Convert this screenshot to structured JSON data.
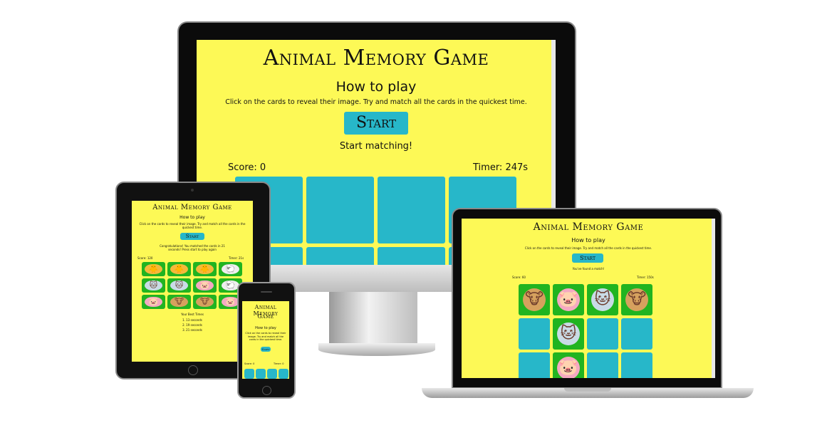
{
  "game": {
    "title": "Animal Memory Game",
    "title_small": "Animal Memory Game",
    "how_to_play": "How to play",
    "instructions": "Click on the cards to reveal their image. Try and match all the cards in the quickest time.",
    "start_label": "Start",
    "accent_color": "#27b7c9",
    "background_color": "#fdf956",
    "matched_color": "#21b420"
  },
  "desktop": {
    "status": "Start matching!",
    "score_label": "Score: 0",
    "timer_label": "Timer: 247s"
  },
  "laptop": {
    "status": "You've found a match!",
    "score_label": "Score: 60",
    "timer_label": "Timer: 150s",
    "cards": [
      {
        "state": "open",
        "animal": "cow"
      },
      {
        "state": "open",
        "animal": "pig"
      },
      {
        "state": "open",
        "animal": "cat"
      },
      {
        "state": "open",
        "animal": "cow"
      },
      {
        "state": "closed",
        "animal": ""
      },
      {
        "state": "open",
        "animal": "cat"
      },
      {
        "state": "closed",
        "animal": ""
      },
      {
        "state": "closed",
        "animal": ""
      },
      {
        "state": "closed",
        "animal": ""
      },
      {
        "state": "open",
        "animal": "pig"
      },
      {
        "state": "closed",
        "animal": ""
      },
      {
        "state": "closed",
        "animal": ""
      }
    ]
  },
  "tablet": {
    "status": "Congratulations! You matched the cards in 21 seconds! Press start to play again",
    "score_label": "Score: 120",
    "timer_label": "Timer: 21s",
    "best_times_title": "Your Best Times",
    "best_times": [
      "1. 13 seconds",
      "2. 19 seconds",
      "3. 21 seconds"
    ],
    "cards": [
      {
        "state": "open",
        "animal": "chick"
      },
      {
        "state": "open",
        "animal": "chick"
      },
      {
        "state": "open",
        "animal": "chick"
      },
      {
        "state": "open",
        "animal": "sheep"
      },
      {
        "state": "open",
        "animal": "cat"
      },
      {
        "state": "open",
        "animal": "cat"
      },
      {
        "state": "open",
        "animal": "pig"
      },
      {
        "state": "open",
        "animal": "sheep"
      },
      {
        "state": "open",
        "animal": "pig"
      },
      {
        "state": "open",
        "animal": "cow"
      },
      {
        "state": "open",
        "animal": "cow"
      },
      {
        "state": "open",
        "animal": "pig"
      }
    ]
  },
  "phone": {
    "title_line1": "Animal Memory",
    "title_line2": "Game",
    "score_label": "Score: 0",
    "timer_label": "Timer: 0"
  }
}
